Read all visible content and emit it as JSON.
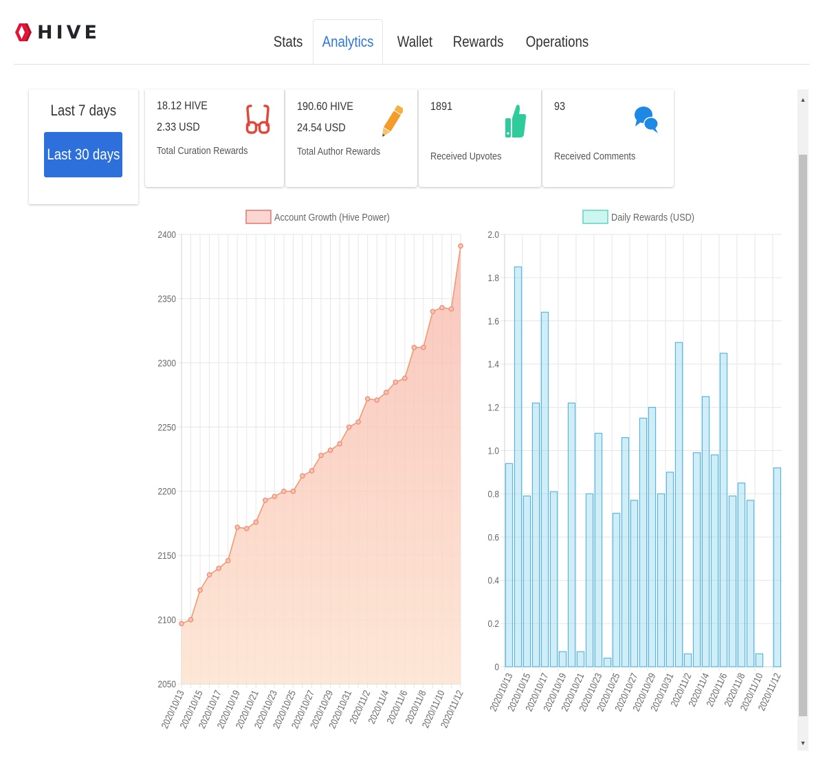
{
  "app": {
    "name": "HIVE"
  },
  "tabs": [
    {
      "label": "Stats",
      "active": false
    },
    {
      "label": "Analytics",
      "active": true
    },
    {
      "label": "Wallet",
      "active": false
    },
    {
      "label": "Rewards",
      "active": false
    },
    {
      "label": "Operations",
      "active": false
    }
  ],
  "range": {
    "last7": "Last 7 days",
    "last30": "Last 30 days",
    "selected": "Last 30 days"
  },
  "cards": [
    {
      "line1": "18.12 HIVE",
      "line2": "2.33 USD",
      "label": "Total Curation Rewards",
      "icon": "glasses-icon",
      "color": "#e0483a"
    },
    {
      "line1": "190.60 HIVE",
      "line2": "24.54 USD",
      "label": "Total Author Rewards",
      "icon": "pencil-icon",
      "color": "#f39c2a"
    },
    {
      "line1": "1891",
      "line2": "",
      "label": "Received Upvotes",
      "icon": "thumbs-up-icon",
      "color": "#2ecc9a"
    },
    {
      "line1": "93",
      "line2": "",
      "label": "Received Comments",
      "icon": "comments-icon",
      "color": "#1e88e5"
    }
  ],
  "chart_data": [
    {
      "type": "area",
      "legend": "Account Growth (Hive Power)",
      "legend_placement": "top",
      "color": "#ee8a6e",
      "x": [
        "2020/10/13",
        "2020/10/14",
        "2020/10/15",
        "2020/10/16",
        "2020/10/17",
        "2020/10/18",
        "2020/10/19",
        "2020/10/20",
        "2020/10/21",
        "2020/10/22",
        "2020/10/23",
        "2020/10/24",
        "2020/10/25",
        "2020/10/26",
        "2020/10/27",
        "2020/10/28",
        "2020/10/29",
        "2020/10/30",
        "2020/10/31",
        "2020/11/1",
        "2020/11/2",
        "2020/11/3",
        "2020/11/4",
        "2020/11/5",
        "2020/11/6",
        "2020/11/7",
        "2020/11/8",
        "2020/11/9",
        "2020/11/10",
        "2020/11/11",
        "2020/11/12"
      ],
      "tick_labels": [
        "2020/10/13",
        "2020/10/15",
        "2020/10/17",
        "2020/10/19",
        "2020/10/21",
        "2020/10/23",
        "2020/10/25",
        "2020/10/27",
        "2020/10/29",
        "2020/10/31",
        "2020/11/2",
        "2020/11/4",
        "2020/11/6",
        "2020/11/8",
        "2020/11/10",
        "2020/11/12"
      ],
      "values": [
        2097,
        2100,
        2123,
        2135,
        2140,
        2146,
        2172,
        2171,
        2176,
        2193,
        2196,
        2200,
        2200,
        2212,
        2216,
        2228,
        2232,
        2237,
        2250,
        2254,
        2272,
        2271,
        2277,
        2285,
        2288,
        2312,
        2312,
        2340,
        2343,
        2342,
        2391
      ],
      "ylim": [
        2050,
        2400
      ],
      "yticks": [
        2050,
        2100,
        2150,
        2200,
        2250,
        2300,
        2350,
        2400
      ],
      "grid": true
    },
    {
      "type": "bar",
      "legend": "Daily Rewards (USD)",
      "legend_placement": "top",
      "color": "#6ec6e8",
      "x": [
        "2020/10/13",
        "2020/10/14",
        "2020/10/15",
        "2020/10/16",
        "2020/10/17",
        "2020/10/18",
        "2020/10/19",
        "2020/10/20",
        "2020/10/21",
        "2020/10/22",
        "2020/10/23",
        "2020/10/24",
        "2020/10/25",
        "2020/10/26",
        "2020/10/27",
        "2020/10/28",
        "2020/10/29",
        "2020/10/30",
        "2020/10/31",
        "2020/11/1",
        "2020/11/2",
        "2020/11/3",
        "2020/11/4",
        "2020/11/5",
        "2020/11/6",
        "2020/11/7",
        "2020/11/8",
        "2020/11/9",
        "2020/11/10",
        "2020/11/11",
        "2020/11/12"
      ],
      "tick_labels": [
        "2020/10/13",
        "2020/10/15",
        "2020/10/17",
        "2020/10/19",
        "2020/10/21",
        "2020/10/23",
        "2020/10/25",
        "2020/10/27",
        "2020/10/29",
        "2020/10/31",
        "2020/11/2",
        "2020/11/4",
        "2020/11/6",
        "2020/11/8",
        "2020/11/10",
        "2020/11/12"
      ],
      "values": [
        0.94,
        1.85,
        0.79,
        1.22,
        1.64,
        0.81,
        0.07,
        1.22,
        0.07,
        0.8,
        1.08,
        0.04,
        0.71,
        1.06,
        0.77,
        1.15,
        1.2,
        0.8,
        0.9,
        1.5,
        0.06,
        0.99,
        1.25,
        0.98,
        1.45,
        0.79,
        0.85,
        0.77,
        0.06,
        0.0,
        0.92
      ],
      "ylim": [
        0,
        2.0
      ],
      "yticks": [
        "0",
        "0.2",
        "0.4",
        "0.6",
        "0.8",
        "1.0",
        "1.2",
        "1.4",
        "1.6",
        "1.8",
        "2.0"
      ],
      "grid": true
    }
  ]
}
